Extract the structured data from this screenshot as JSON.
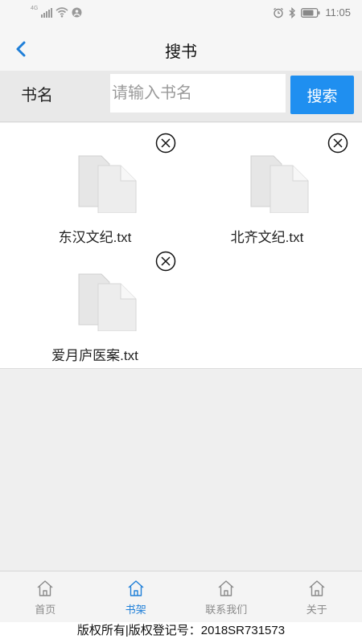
{
  "status": {
    "time": "11:05",
    "network": "4G"
  },
  "header": {
    "title": "搜书"
  },
  "search": {
    "label": "书名",
    "placeholder": "请输入书名",
    "button": "搜索"
  },
  "books": [
    {
      "name": "东汉文纪.txt"
    },
    {
      "name": "北齐文纪.txt"
    },
    {
      "name": "爱月庐医案.txt"
    }
  ],
  "nav": {
    "items": [
      {
        "label": "首页",
        "icon": "home-icon"
      },
      {
        "label": "书架",
        "icon": "home-icon",
        "active": true
      },
      {
        "label": "联系我们",
        "icon": "home-icon"
      },
      {
        "label": "关于",
        "icon": "home-icon"
      }
    ]
  },
  "footer": {
    "text": "版权所有|版权登记号：2018SR731573"
  },
  "colors": {
    "accent": "#1f8ff0",
    "active_nav": "#1f7fd8"
  }
}
